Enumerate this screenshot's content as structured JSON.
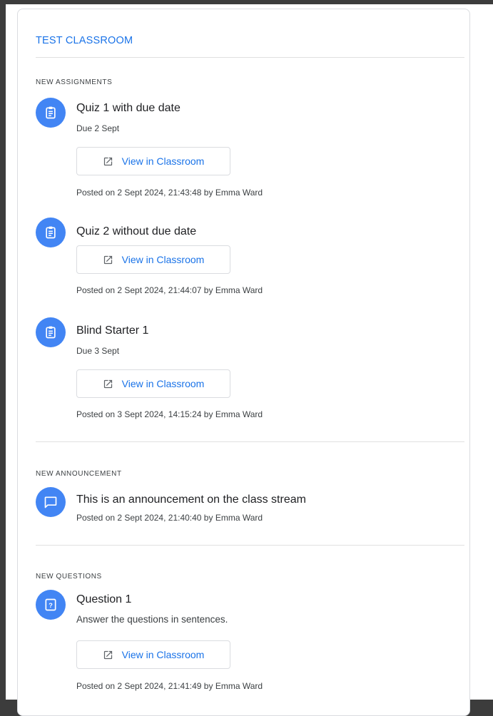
{
  "classroom": {
    "title": "TEST CLASSROOM"
  },
  "assignments": {
    "label": "NEW ASSIGNMENTS",
    "items": [
      {
        "title": "Quiz 1 with due date",
        "due": "Due 2 Sept",
        "button": "View in Classroom",
        "posted": "Posted on 2 Sept 2024, 21:43:48 by Emma Ward",
        "icon": "assignment-icon"
      },
      {
        "title": "Quiz 2 without due date",
        "button": "View in Classroom",
        "posted": "Posted on 2 Sept 2024, 21:44:07 by Emma Ward",
        "icon": "assignment-icon"
      },
      {
        "title": "Blind Starter 1",
        "due": "Due 3 Sept",
        "button": "View in Classroom",
        "posted": "Posted on 3 Sept 2024, 14:15:24 by Emma Ward",
        "icon": "assignment-icon"
      }
    ]
  },
  "announcements": {
    "label": "NEW ANNOUNCEMENT",
    "items": [
      {
        "title": "This is an announcement on the class stream",
        "posted": "Posted on 2 Sept 2024, 21:40:40 by Emma Ward",
        "icon": "announcement-icon"
      }
    ]
  },
  "questions": {
    "label": "NEW QUESTIONS",
    "items": [
      {
        "title": "Question 1",
        "description": "Answer the questions in sentences.",
        "button": "View in Classroom",
        "posted": "Posted on 2 Sept 2024, 21:41:49 by Emma Ward",
        "icon": "question-icon"
      }
    ]
  },
  "colors": {
    "accent": "#1a73e8",
    "avatar": "#4285f4",
    "divider": "#e0e0e0"
  }
}
